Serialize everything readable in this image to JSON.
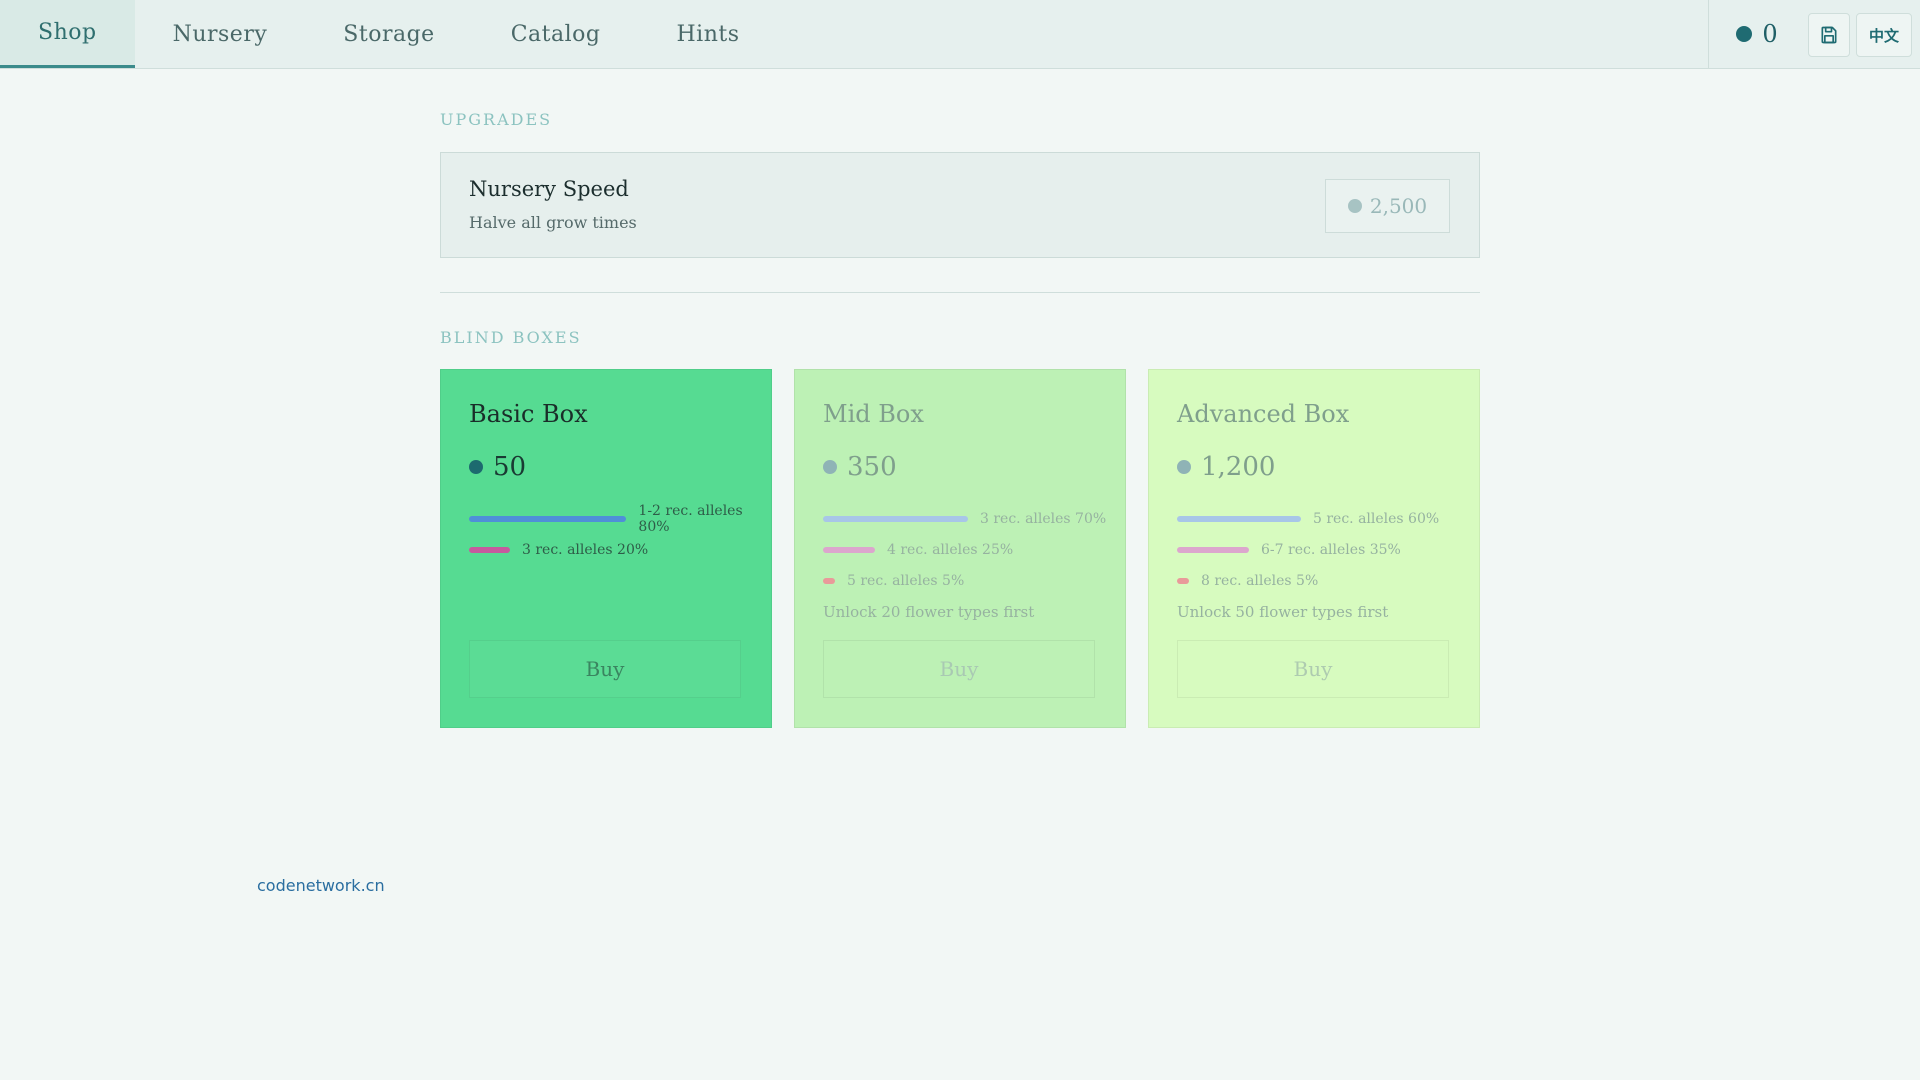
{
  "nav": {
    "tabs": [
      {
        "label": "Shop",
        "active": true
      },
      {
        "label": "Nursery",
        "active": false
      },
      {
        "label": "Storage",
        "active": false
      },
      {
        "label": "Catalog",
        "active": false
      },
      {
        "label": "Hints",
        "active": false
      }
    ],
    "coins": "0",
    "save_icon": "save-icon",
    "language_label": "中文"
  },
  "upgrades": {
    "section_title": "UPGRADES",
    "items": [
      {
        "name": "Nursery Speed",
        "description": "Halve all grow times",
        "price": "2,500"
      }
    ]
  },
  "blind_boxes": {
    "section_title": "BLIND BOXES",
    "boxes": [
      {
        "name": "Basic Box",
        "price": "50",
        "odds": [
          {
            "label": "1-2 rec. alleles 80%",
            "percent": 80,
            "color": "#4f8fd8"
          },
          {
            "label": "3 rec. alleles 20%",
            "percent": 20,
            "color": "#c65a9e"
          }
        ],
        "lock_text": "",
        "buy_label": "Buy",
        "background": "#56db92"
      },
      {
        "name": "Mid Box",
        "price": "350",
        "odds": [
          {
            "label": "3 rec. alleles 70%",
            "percent": 70,
            "color": "#a8c6e8"
          },
          {
            "label": "4 rec. alleles 25%",
            "percent": 25,
            "color": "#dca6cd"
          },
          {
            "label": "5 rec. alleles 5%",
            "percent": 5,
            "color": "#e99a9a"
          }
        ],
        "lock_text": "Unlock 20 flower types first",
        "buy_label": "Buy",
        "background": "#bdf1b5"
      },
      {
        "name": "Advanced Box",
        "price": "1,200",
        "odds": [
          {
            "label": "5 rec. alleles 60%",
            "percent": 60,
            "color": "#a8c6e8"
          },
          {
            "label": "6-7 rec. alleles 35%",
            "percent": 35,
            "color": "#dca6cd"
          },
          {
            "label": "8 rec. alleles 5%",
            "percent": 5,
            "color": "#e99a9a"
          }
        ],
        "lock_text": "Unlock 50 flower types first",
        "buy_label": "Buy",
        "background": "#d7fbbf"
      }
    ]
  },
  "footer": {
    "link_text": "codenetwork.cn"
  }
}
